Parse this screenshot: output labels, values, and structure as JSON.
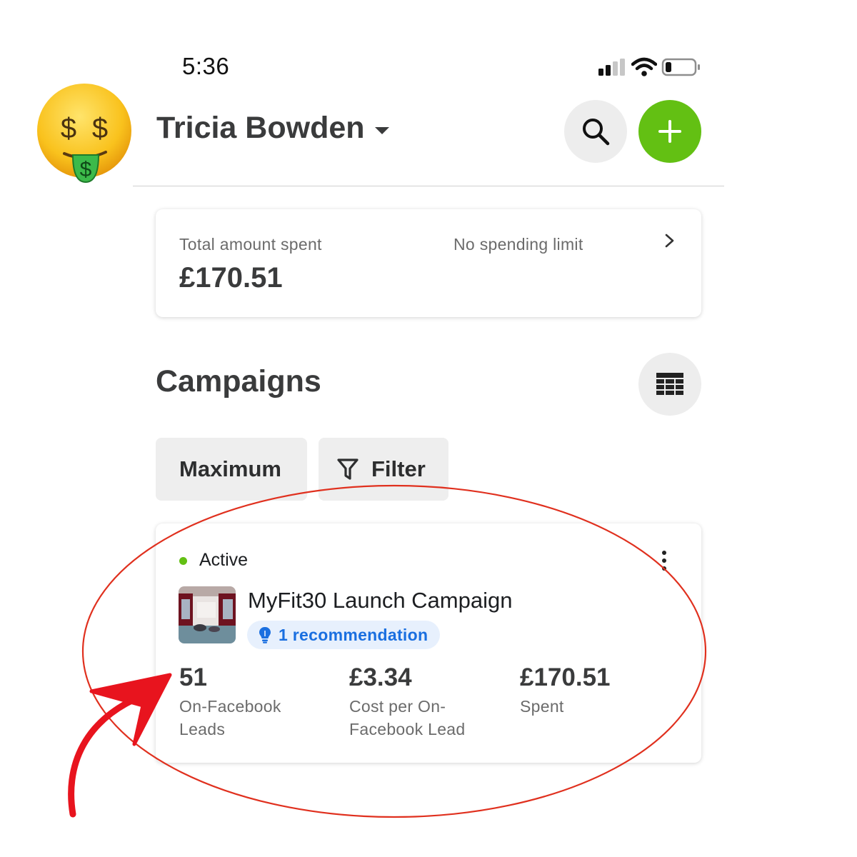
{
  "status_bar": {
    "time": "5:36",
    "signal_icon": "cellular-signal-icon",
    "wifi_icon": "wifi-icon",
    "battery_icon": "battery-low-icon"
  },
  "header": {
    "avatar_icon": "money-mouth-face-emoji",
    "account_name": "Tricia Bowden",
    "search_icon": "search-icon",
    "add_icon": "plus-icon",
    "add_button_color": "#63c013"
  },
  "spend_summary": {
    "total_label": "Total amount spent",
    "total_value": "£170.51",
    "limit_label": "No spending limit"
  },
  "campaigns": {
    "title": "Campaigns",
    "table_view_icon": "table-icon",
    "chips": [
      {
        "label": "Maximum"
      },
      {
        "label": "Filter",
        "icon": "filter-funnel-icon"
      }
    ],
    "items": [
      {
        "status": "Active",
        "status_color": "#63c013",
        "name": "MyFit30 Launch Campaign",
        "recommendation": "1 recommendation",
        "recommendation_icon": "lightbulb-icon",
        "metrics": [
          {
            "value": "51",
            "label_line1": "On-Facebook",
            "label_line2": "Leads"
          },
          {
            "value": "£3.34",
            "label_line1": "Cost per On-",
            "label_line2": "Facebook Lead"
          },
          {
            "value": "£170.51",
            "label_line1": "Spent",
            "label_line2": ""
          }
        ]
      }
    ]
  },
  "annotation": {
    "highlight_color": "#e0301e",
    "arrow_color": "#e8141e"
  }
}
